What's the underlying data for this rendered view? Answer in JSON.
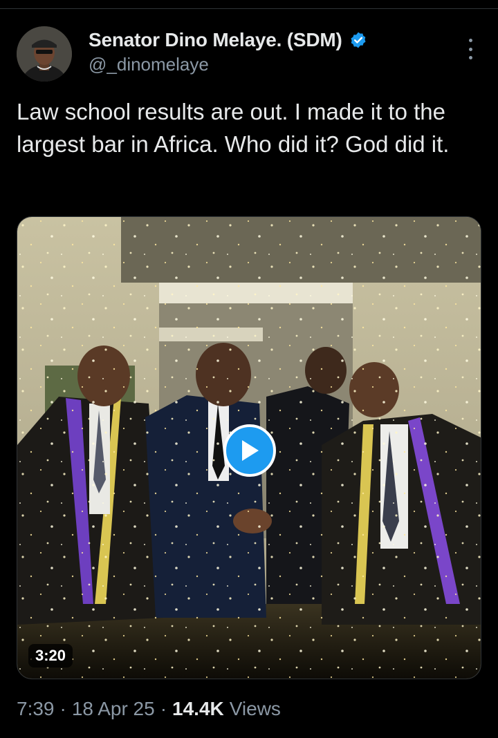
{
  "author": {
    "display_name": "Senator Dino Melaye. (SDM)",
    "handle": "@_dinomelaye",
    "verified": true
  },
  "tweet": {
    "text": "Law school results are out. I made it to the largest bar in Africa. Who did it? God did it."
  },
  "media": {
    "type": "video",
    "duration": "3:20"
  },
  "meta": {
    "time": "7:39",
    "separator_1": "·",
    "date": "18 Apr 25",
    "separator_2": "·",
    "views_count": "14.4K",
    "views_label": "Views"
  },
  "colors": {
    "background": "#000000",
    "text_primary": "#e7e9ea",
    "text_secondary": "#8b98a5",
    "accent": "#1d9bf0"
  },
  "icons": {
    "verified": "verified-badge-icon",
    "more": "more-options-icon",
    "play": "play-icon"
  }
}
